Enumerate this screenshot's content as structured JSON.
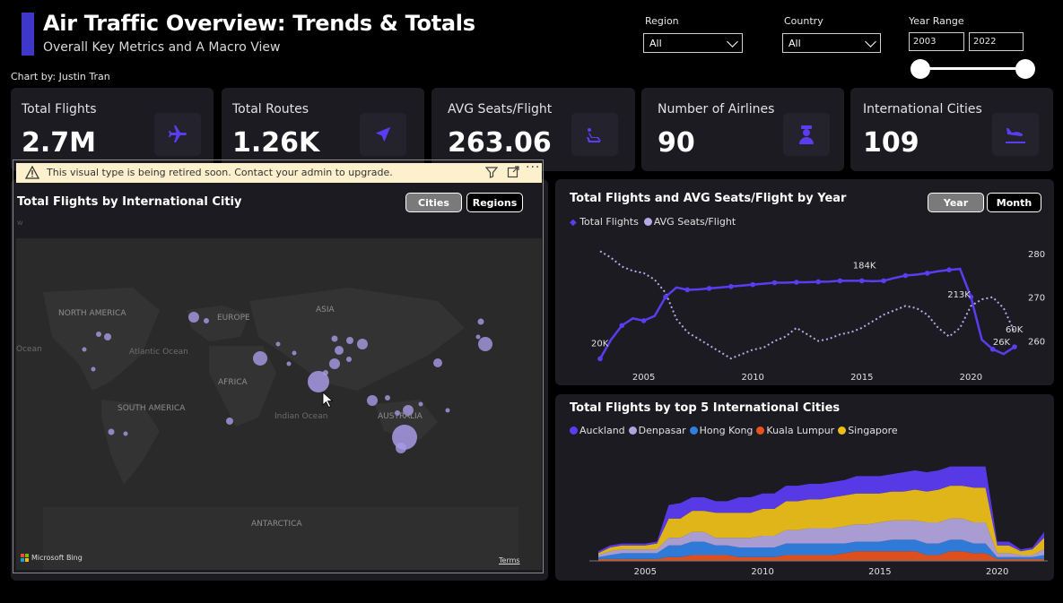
{
  "header": {
    "title": "Air Traffic Overview: Trends & Totals",
    "subtitle": "Overall Key Metrics and A Macro View",
    "byline": "Chart by: Justin Tran"
  },
  "filters": {
    "region_label": "Region",
    "region_value": "All",
    "country_label": "Country",
    "country_value": "All",
    "year_label": "Year Range",
    "year_from": "2003",
    "year_to": "2022"
  },
  "kpis": [
    {
      "label": "Total Flights",
      "value": "2.7M",
      "icon": "airplane-icon"
    },
    {
      "label": "Total Routes",
      "value": "1.26K",
      "icon": "navigation-arrow-icon"
    },
    {
      "label": "AVG Seats/Flight",
      "value": "263.06",
      "icon": "airline-seat-icon"
    },
    {
      "label": "Number of Airlines",
      "value": "90",
      "icon": "pilot-icon"
    },
    {
      "label": "International Cities",
      "value": "109",
      "icon": "airplane-landing-icon"
    }
  ],
  "map_panel": {
    "warning": "This visual type is being retired soon. Contact your admin to upgrade.",
    "title": "Total Flights by International Citiy",
    "btn_cities": "Cities",
    "btn_regions": "Regions",
    "corner_letter": "w",
    "labels": {
      "north_america": "NORTH AMERICA",
      "europe": "EUROPE",
      "asia": "ASIA",
      "africa": "AFRICA",
      "south_america": "SOUTH AMERICA",
      "australia": "AUSTRALIA",
      "antarctica": "ANTARCTICA",
      "atlantic": "Atlantic Ocean",
      "indian": "Indian Ocean",
      "ocean_left": "Ocean"
    },
    "bing": "Microsoft Bing",
    "terms": "Terms"
  },
  "line_panel": {
    "title": "Total Flights and AVG Seats/Flight by Year",
    "btn_year": "Year",
    "btn_month": "Month"
  },
  "area_panel": {
    "title": "Total Flights by top 5 International Cities"
  },
  "chart_data": [
    {
      "type": "line",
      "title": "Total Flights and AVG Seats/Flight by Year",
      "x": [
        2003,
        2003.5,
        2004,
        2004.5,
        2005,
        2005.5,
        2006,
        2006.5,
        2007,
        2007.5,
        2008,
        2008.5,
        2009,
        2009.5,
        2010,
        2010.5,
        2011,
        2011.5,
        2012,
        2012.5,
        2013,
        2013.5,
        2014,
        2014.5,
        2015,
        2015.5,
        2016,
        2016.5,
        2017,
        2017.5,
        2018,
        2018.5,
        2019,
        2019.5,
        2020,
        2020.5,
        2021,
        2021.5,
        2022
      ],
      "x_ticks": [
        2005,
        2010,
        2015,
        2020
      ],
      "y2_ticks": [
        260,
        270,
        280
      ],
      "y2_tick_labels": [
        "260",
        "270",
        "280"
      ],
      "series": [
        {
          "name": "Total Flights",
          "color": "#5b3cf0",
          "axis": "left",
          "values": [
            20000,
            60000,
            90000,
            105000,
            100000,
            110000,
            150000,
            170000,
            165000,
            166000,
            168000,
            170000,
            172000,
            174000,
            176000,
            178000,
            180000,
            180000,
            181000,
            181000,
            182000,
            182500,
            184000,
            184000,
            184000,
            183000,
            184000,
            190000,
            195000,
            197000,
            200000,
            204000,
            207000,
            209000,
            150000,
            60000,
            40000,
            30000,
            45000
          ],
          "labels": [
            {
              "i": 0,
              "text": "20K"
            },
            {
              "i": 24,
              "text": "184K"
            },
            {
              "i": 33,
              "text": "213K"
            },
            {
              "i": 37,
              "text": "26K"
            },
            {
              "i": 38,
              "text": "60K"
            }
          ]
        },
        {
          "name": "AVG Seats/Flight",
          "color": "#b7a8e6",
          "axis": "right",
          "values": [
            280.5,
            279,
            277,
            276,
            275.5,
            274,
            271,
            265,
            262,
            260.5,
            259,
            257.5,
            256,
            257,
            258,
            258.5,
            260,
            261,
            263,
            261.5,
            260,
            260.5,
            261.5,
            262,
            263,
            264.5,
            266,
            267,
            268,
            267.5,
            266,
            263,
            261,
            263,
            268,
            269.5,
            270,
            267.5,
            262
          ]
        }
      ],
      "y2lim": [
        255,
        282
      ]
    },
    {
      "type": "area",
      "title": "Total Flights by top 5 International Cities",
      "x_ticks": [
        2005,
        2010,
        2015,
        2020
      ],
      "x": [
        2003,
        2003.5,
        2004,
        2004.5,
        2005,
        2005.5,
        2006,
        2006.5,
        2007,
        2007.5,
        2008,
        2008.5,
        2009,
        2009.5,
        2010,
        2010.5,
        2011,
        2011.5,
        2012,
        2012.5,
        2013,
        2013.5,
        2014,
        2014.5,
        2015,
        2015.5,
        2016,
        2016.5,
        2017,
        2017.5,
        2018,
        2018.5,
        2019,
        2019.5,
        2020,
        2020.5,
        2021,
        2021.5,
        2022
      ],
      "series": [
        {
          "name": "Kuala Lumpur",
          "color": "#e8531d",
          "values": [
            1,
            1,
            1,
            1,
            1,
            1,
            2,
            2,
            3,
            3,
            3,
            3,
            2,
            2,
            2,
            2,
            3,
            3,
            3,
            3,
            3,
            4,
            5,
            5,
            5,
            5,
            5,
            5,
            3,
            3,
            5,
            5,
            4,
            4,
            1,
            1,
            1,
            1,
            1
          ]
        },
        {
          "name": "Hong Kong",
          "color": "#2f7fe0",
          "values": [
            1,
            2,
            3,
            3,
            3,
            3,
            6,
            6,
            7,
            7,
            5,
            5,
            5,
            5,
            5,
            5,
            6,
            6,
            6,
            6,
            6,
            5,
            5,
            5,
            5,
            6,
            6,
            6,
            6,
            6,
            6,
            6,
            5,
            5,
            1,
            1,
            1,
            1,
            2
          ]
        },
        {
          "name": "Denpasar",
          "color": "#b1a3dd",
          "values": [
            1,
            2,
            2,
            2,
            2,
            2,
            4,
            4,
            5,
            5,
            4,
            4,
            5,
            5,
            6,
            6,
            7,
            7,
            8,
            8,
            8,
            9,
            9,
            9,
            10,
            10,
            10,
            10,
            11,
            11,
            11,
            11,
            11,
            11,
            2,
            2,
            1,
            1,
            3
          ]
        },
        {
          "name": "Singapore",
          "color": "#ebbe1a",
          "values": [
            1,
            2,
            2,
            2,
            2,
            3,
            10,
            10,
            11,
            11,
            13,
            13,
            13,
            13,
            14,
            14,
            15,
            15,
            15,
            15,
            16,
            16,
            16,
            16,
            15,
            15,
            15,
            16,
            16,
            17,
            17,
            17,
            18,
            18,
            4,
            4,
            2,
            3,
            6
          ]
        },
        {
          "name": "Auckland",
          "color": "#5b3cf0",
          "values": [
            1,
            1,
            1,
            1,
            1,
            1,
            7,
            8,
            7,
            7,
            6,
            6,
            8,
            8,
            8,
            8,
            8,
            8,
            8,
            8,
            8,
            8,
            9,
            9,
            9,
            9,
            10,
            10,
            10,
            10,
            10,
            10,
            11,
            11,
            2,
            2,
            1,
            1,
            3
          ]
        }
      ],
      "legend_order": [
        "Auckland",
        "Denpasar",
        "Hong Kong",
        "Kuala Lumpur",
        "Singapore"
      ]
    }
  ],
  "colors": {
    "accent": "#3f37c9",
    "panel": "#1c1b21",
    "icon": "#5b3cf0",
    "bubble": "#a99ae6",
    "map_bg": "#2a2a2a",
    "land": "#333333"
  }
}
